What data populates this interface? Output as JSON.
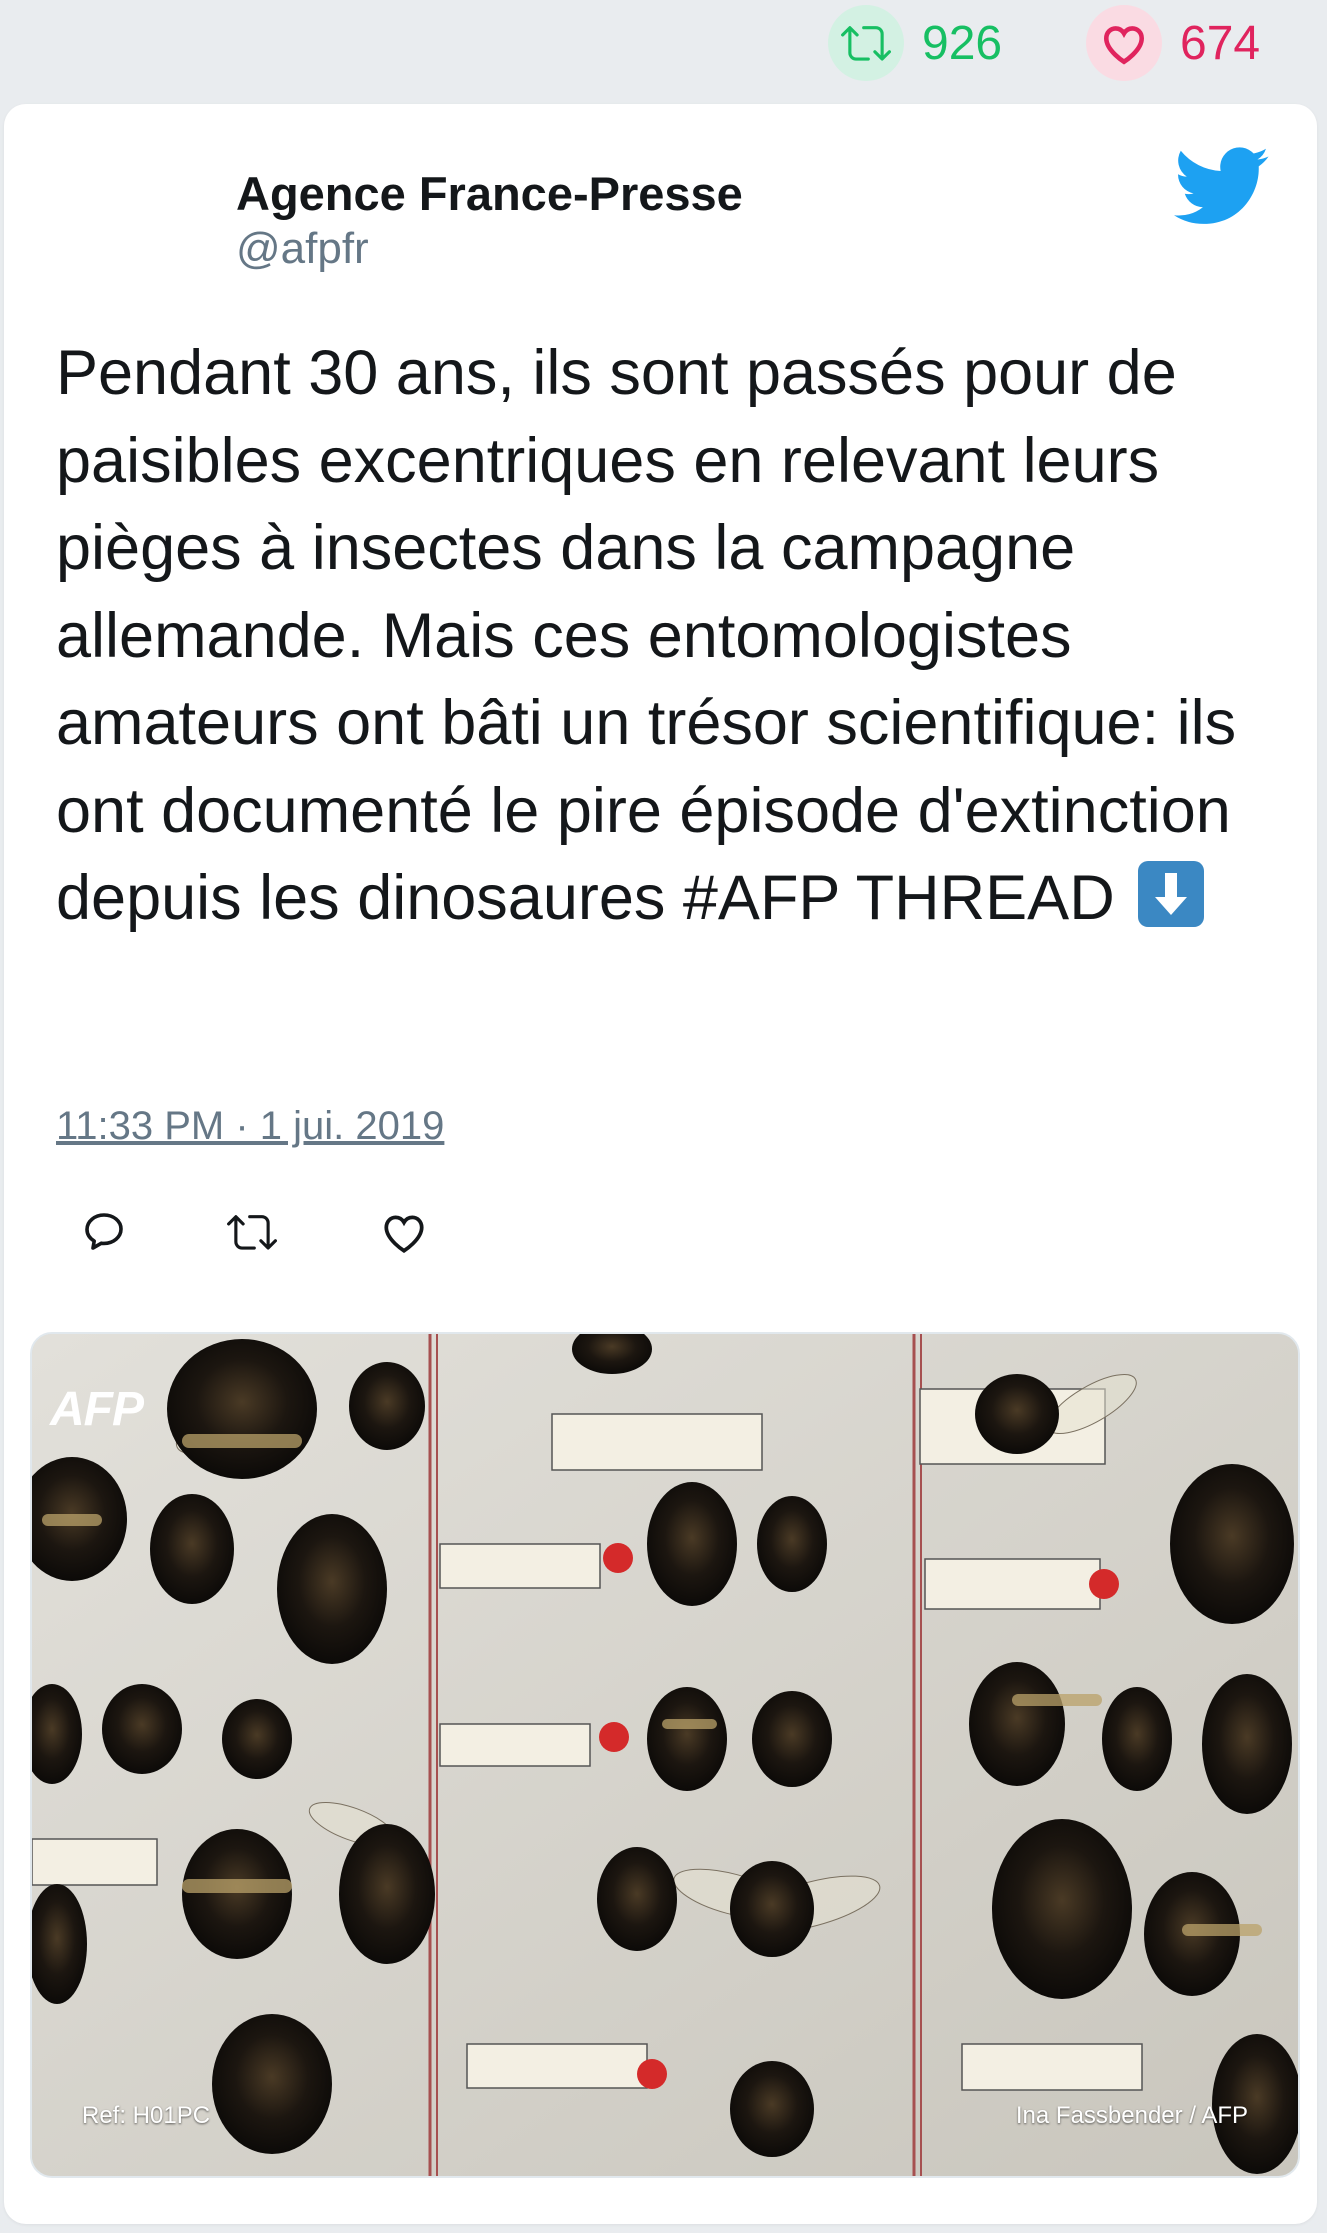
{
  "stats": {
    "retweets": "926",
    "likes": "674"
  },
  "colors": {
    "retweet_green": "#17bf63",
    "like_red": "#e0245e",
    "twitter_blue": "#1da1f2",
    "text_gray": "#657786"
  },
  "tweet": {
    "author_name": "Agence France-Presse",
    "author_handle": "@afpfr",
    "text": "Pendant 30 ans, ils sont passés pour de paisibles excentriques en relevant leurs pièges à insectes dans la campagne allemande. Mais ces entomologistes amateurs ont bâti un trésor scientifique: ils ont documenté le pire épisode d'extinction depuis les dinosaures #AFP THREAD",
    "emoji": "down-arrow-emoji",
    "timestamp": "11:33 PM · 1 jui. 2019"
  },
  "actions": {
    "reply_icon": "reply-icon",
    "retweet_icon": "retweet-icon",
    "like_icon": "heart-icon"
  },
  "photo": {
    "logo": "AFP",
    "ref": "Ref: H01PC",
    "credit": "Ina Fassbender / AFP"
  }
}
